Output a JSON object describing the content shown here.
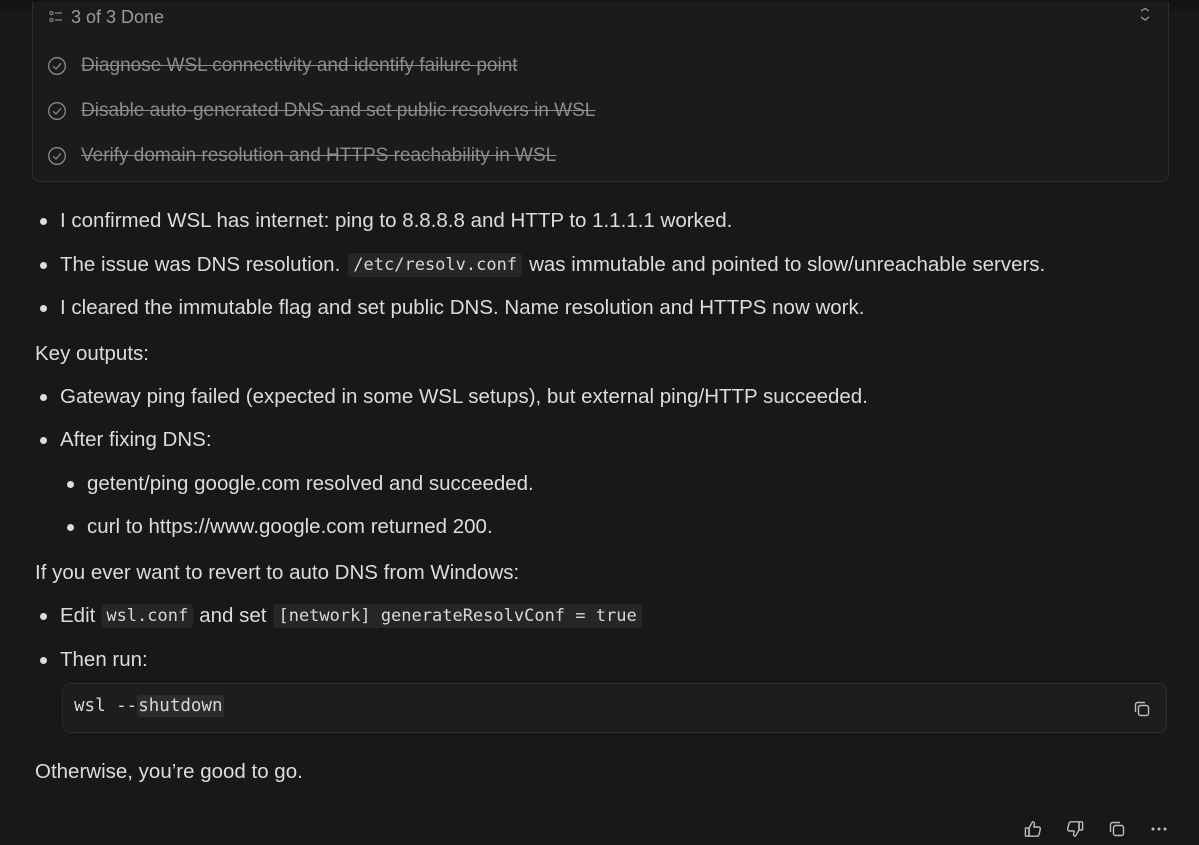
{
  "todo": {
    "summary": "3 of 3 Done",
    "items": [
      {
        "label": "Diagnose WSL connectivity and identify failure point",
        "done": true
      },
      {
        "label": "Disable auto-generated DNS and set public resolvers in WSL",
        "done": true
      },
      {
        "label": "Verify domain resolution and HTTPS reachability in WSL",
        "done": true
      }
    ]
  },
  "summary_bullets": [
    {
      "text": "I confirmed WSL has internet: ping to 8.8.8.8 and HTTP to 1.1.1.1 worked."
    },
    {
      "before": "The issue was DNS resolution.",
      "code": "/etc/resolv.conf",
      "after": "was immutable and pointed to slow/unreachable servers."
    },
    {
      "text": "I cleared the immutable flag and set public DNS. Name resolution and HTTPS now work."
    }
  ],
  "key_outputs_label": "Key outputs:",
  "key_outputs": [
    {
      "text": "Gateway ping failed (expected in some WSL setups), but external ping/HTTP succeeded."
    },
    {
      "text": "After fixing DNS:"
    }
  ],
  "dns_sub": [
    {
      "text": "getent/ping google.com resolved and succeeded."
    },
    {
      "text": "curl to https://www.google.com returned 200."
    }
  ],
  "revert_label": "If you ever want to revert to auto DNS from Windows:",
  "revert_steps": {
    "edit_before": "Edit",
    "edit_code1": "wsl.conf",
    "edit_middle": "and set",
    "edit_code2": "[network] generateResolvConf = true",
    "then_run": "Then run:"
  },
  "code_block": {
    "prefix": "wsl --",
    "highlight": "shutdown"
  },
  "closing": "Otherwise, you’re good to go.",
  "icons": [
    "list-icon",
    "chevron-collapse-icon",
    "check-circle-icon",
    "copy-icon",
    "thumbs-up-icon",
    "thumbs-down-icon",
    "more-icon"
  ]
}
